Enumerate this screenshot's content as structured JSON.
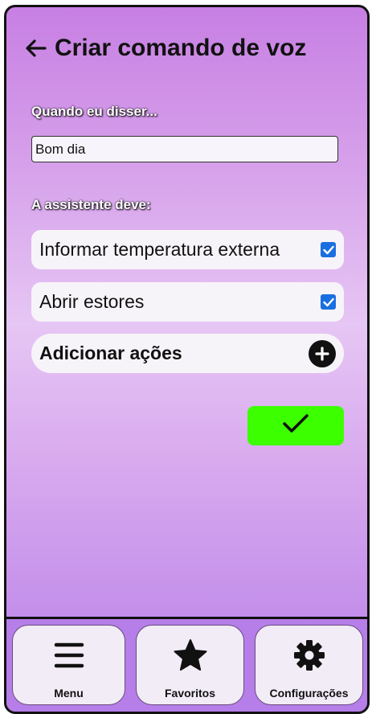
{
  "header": {
    "title": "Criar comando de voz",
    "back_icon": "arrow-left-icon"
  },
  "trigger": {
    "label": "Quando eu disser...",
    "value": "Bom dia"
  },
  "actions": {
    "label": "A assistente deve:",
    "items": [
      {
        "label": "Informar temperatura externa",
        "checked": true
      },
      {
        "label": "Abrir estores",
        "checked": true
      }
    ],
    "add_label": "Adicionar ações",
    "add_icon": "plus-circle-icon"
  },
  "confirm": {
    "icon": "checkmark-icon",
    "color": "#3cff00"
  },
  "nav": {
    "items": [
      {
        "label": "Menu",
        "icon": "hamburger-icon"
      },
      {
        "label": "Favoritos",
        "icon": "star-icon"
      },
      {
        "label": "Configurações",
        "icon": "gear-icon"
      }
    ]
  },
  "colors": {
    "checkbox": "#1a6fe0",
    "nav_background": "#b67ee8"
  }
}
